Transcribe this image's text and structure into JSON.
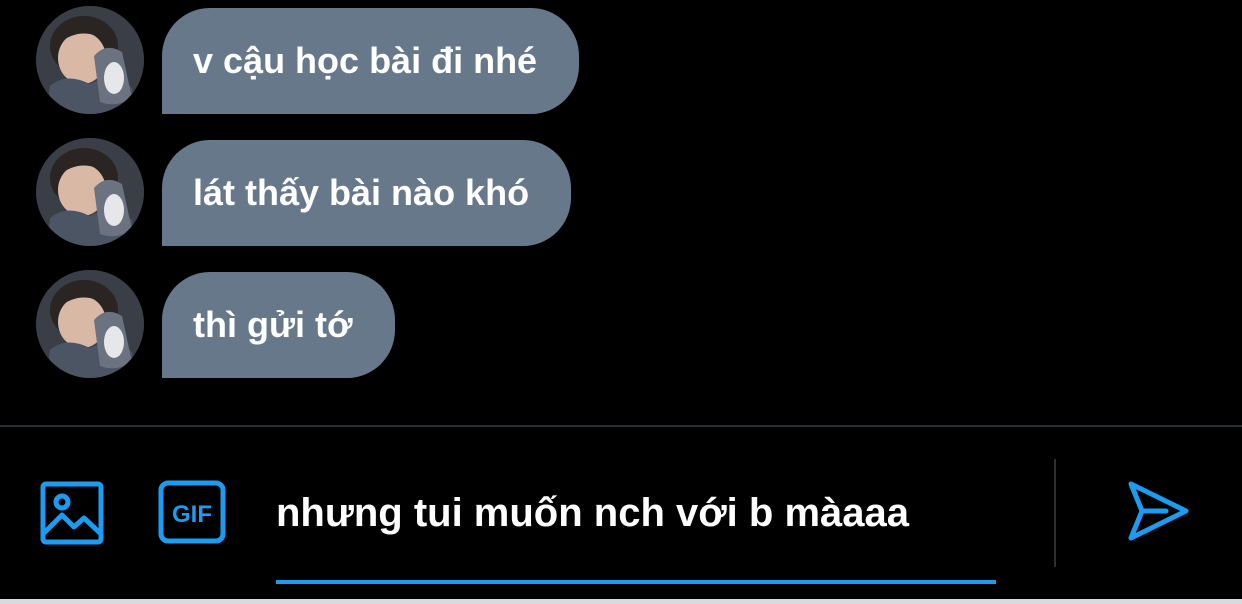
{
  "conversation": {
    "messages": [
      {
        "text": "v cậu học bài đi nhé"
      },
      {
        "text": "lát thấy bài nào khó"
      },
      {
        "text": "thì gửi tớ"
      }
    ]
  },
  "composer": {
    "media_icon": "image-icon",
    "gif_icon": "gif-icon",
    "gif_label": "GIF",
    "input_value": "nhưng tui muốn nch với b màaaa",
    "send_icon": "send-icon"
  },
  "colors": {
    "background": "#000000",
    "bubble": "#66788a",
    "accent": "#1d9bf0",
    "text": "#ffffff"
  }
}
